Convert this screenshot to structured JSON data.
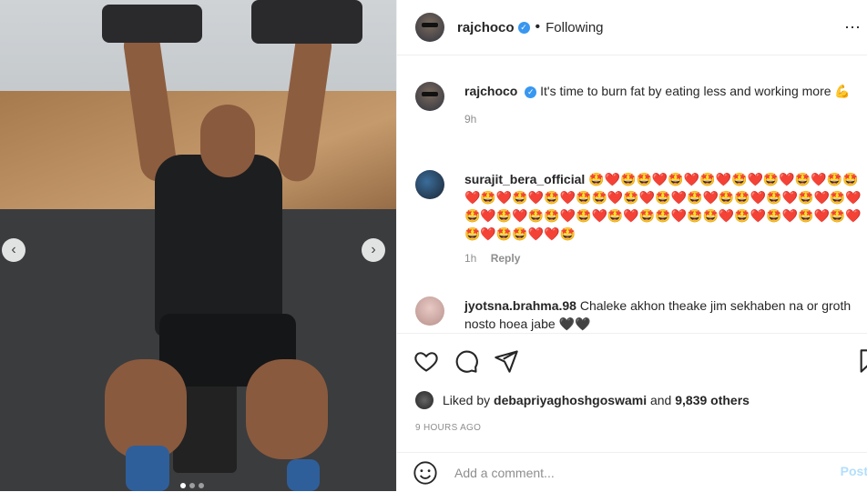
{
  "post": {
    "username": "rajchoco",
    "follow_status": "Following",
    "caption": "It's time to burn fat by eating less and working more 💪",
    "caption_time": "9h",
    "carousel": {
      "dot_count": 3,
      "active_index": 0
    }
  },
  "comments": [
    {
      "username": "surajit_bera_official",
      "text": "🤩❤️🤩🤩❤️🤩❤️🤩❤️🤩❤️🤩❤️🤩❤️🤩🤩❤️🤩❤️🤩❤️🤩❤️🤩🤩❤️🤩❤️🤩❤️🤩❤️🤩🤩❤️🤩❤️🤩❤️🤩❤️🤩❤️🤩❤️🤩🤩❤️🤩❤️🤩❤️🤩🤩❤️🤩🤩❤️🤩❤️🤩❤️🤩❤️🤩❤️🤩❤️🤩🤩❤️❤️🤩",
      "time": "1h",
      "reply_label": "Reply"
    },
    {
      "username": "jyotsna.brahma.98",
      "text": "Chaleke akhon theake jim sekhaben na or groth nosto hoea jabe 🖤🖤"
    }
  ],
  "likes": {
    "prefix": "Liked by",
    "user": "debapriyaghoshgoswami",
    "middle": "and",
    "others": "9,839 others"
  },
  "timestamp": "9 HOURS AGO",
  "comment_box": {
    "placeholder": "Add a comment...",
    "post_label": "Post"
  },
  "icons": [
    "heart-icon",
    "comment-icon",
    "share-icon",
    "bookmark-icon",
    "emoji-icon",
    "verified-icon",
    "more-icon"
  ],
  "colors": {
    "verified": "#3897f0",
    "post_button": "#b2dffc"
  }
}
